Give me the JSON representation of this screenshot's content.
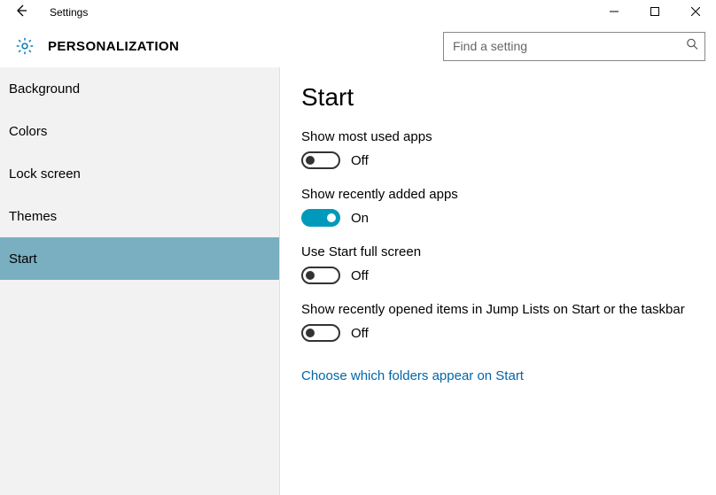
{
  "window": {
    "title": "Settings"
  },
  "header": {
    "category": "PERSONALIZATION"
  },
  "search": {
    "placeholder": "Find a setting",
    "value": ""
  },
  "sidebar": {
    "items": [
      {
        "label": "Background",
        "selected": false
      },
      {
        "label": "Colors",
        "selected": false
      },
      {
        "label": "Lock screen",
        "selected": false
      },
      {
        "label": "Themes",
        "selected": false
      },
      {
        "label": "Start",
        "selected": true
      }
    ]
  },
  "page": {
    "title": "Start",
    "settings": [
      {
        "label": "Show most used apps",
        "on": false,
        "state_label": "Off"
      },
      {
        "label": "Show recently added apps",
        "on": true,
        "state_label": "On"
      },
      {
        "label": "Use Start full screen",
        "on": false,
        "state_label": "Off"
      },
      {
        "label": "Show recently opened items in Jump Lists on Start or the taskbar",
        "on": false,
        "state_label": "Off"
      }
    ],
    "link": "Choose which folders appear on Start"
  }
}
